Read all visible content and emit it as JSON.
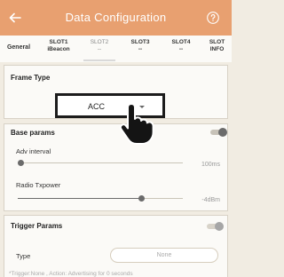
{
  "appbar": {
    "title": "Data Configuration",
    "back_icon": "arrow-left-icon",
    "help_icon": "question-circle-icon",
    "color": "#e8a070"
  },
  "tabs": [
    {
      "line1": "General",
      "line2": ""
    },
    {
      "line1": "SLOT1",
      "line2": "iBeacon"
    },
    {
      "line1": "SLOT2",
      "line2": "--",
      "active": true
    },
    {
      "line1": "SLOT3",
      "line2": "--"
    },
    {
      "line1": "SLOT4",
      "line2": "--"
    },
    {
      "line1": "SLOT",
      "line2": "INFO"
    }
  ],
  "frame_type": {
    "title": "Frame Type",
    "value": "ACC"
  },
  "base_params": {
    "title": "Base params",
    "toggle_on": true,
    "adv_interval": {
      "label": "Adv interval",
      "value": "100ms",
      "level": 0.0
    },
    "radio_txpower": {
      "label": "Radio Txpower",
      "value": "-4dBm",
      "level": 0.76
    }
  },
  "trigger_params": {
    "title": "Trigger Params",
    "toggle_on": false,
    "type_label": "Type",
    "type_value": "None",
    "hint": "*Trigger:None , Action: Advertising for 0 seconds"
  }
}
